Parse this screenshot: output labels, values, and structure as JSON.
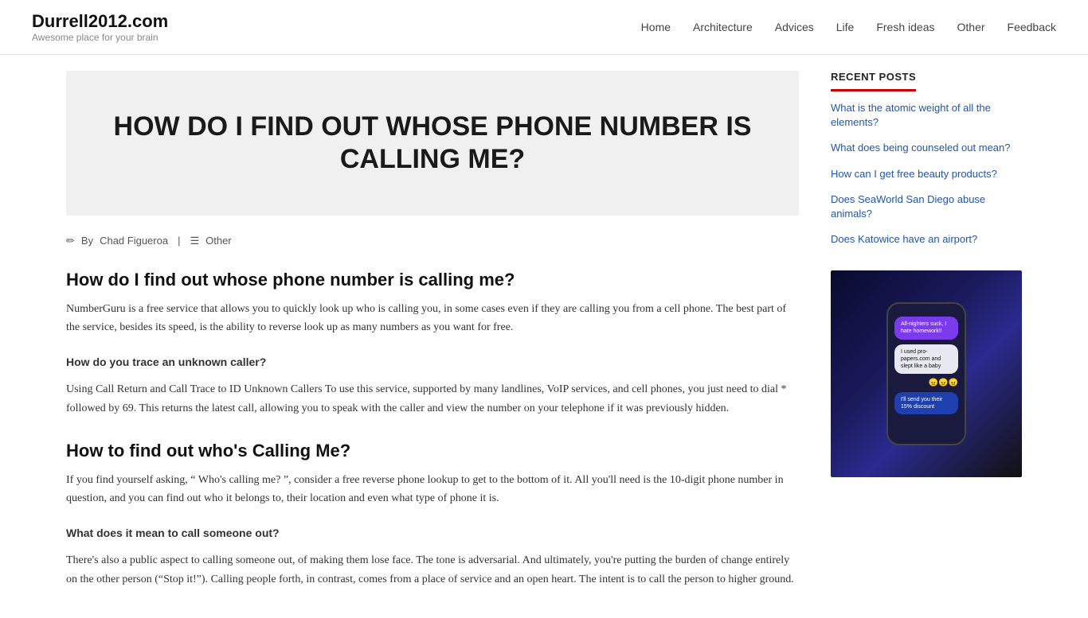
{
  "site": {
    "title": "Durrell2012.com",
    "tagline": "Awesome place for your brain"
  },
  "nav": {
    "items": [
      {
        "label": "Home",
        "href": "#"
      },
      {
        "label": "Architecture",
        "href": "#"
      },
      {
        "label": "Advices",
        "href": "#"
      },
      {
        "label": "Life",
        "href": "#"
      },
      {
        "label": "Fresh ideas",
        "href": "#"
      },
      {
        "label": "Other",
        "href": "#"
      },
      {
        "label": "Feedback",
        "href": "#"
      }
    ]
  },
  "hero": {
    "title": "HOW DO I FIND OUT WHOSE PHONE NUMBER IS CALLING ME?"
  },
  "post": {
    "author": "Chad Figueroa",
    "category": "Other",
    "intro": "How do I find out whose phone number is calling me?",
    "p1": "NumberGuru is a free service that allows you to quickly look up who is calling you, in some cases even if they are calling you from a cell phone. The best part of the service, besides its speed, is the ability to reverse look up as many numbers as you want for free.",
    "h_trace": "How do you trace an unknown caller?",
    "p_trace": "Using Call Return and Call Trace to ID Unknown Callers To use this service, supported by many landlines, VoIP services, and cell phones, you just need to dial * followed by 69. This returns the latest call, allowing you to speak with the caller and view the number on your telephone if it was previously hidden.",
    "h_find": "How to find out who's Calling Me?",
    "p_find": "If you find yourself asking, “ Who's calling me? ”, consider a free reverse phone lookup to get to the bottom of it. All you'll need is the 10-digit phone number in question, and you can find out who it belongs to, their location and even what type of phone it is.",
    "h_callout": "What does it mean to call someone out?",
    "p_callout": "There's also a public aspect to calling someone out, of making them lose face. The tone is adversarial. And ultimately, you're putting the burden of change entirely on the other person (“Stop it!”). Calling people forth, in contrast, comes from a place of service and an open heart. The intent is to call the person to higher ground."
  },
  "sidebar": {
    "recent_posts_label": "RECENT POSTS",
    "recent_posts": [
      {
        "label": "What is the atomic weight of all the elements?",
        "href": "#"
      },
      {
        "label": "What does being counseled out mean?",
        "href": "#"
      },
      {
        "label": "How can I get free beauty products?",
        "href": "#"
      },
      {
        "label": "Does SeaWorld San Diego abuse animals?",
        "href": "#"
      },
      {
        "label": "Does Katowice have an airport?",
        "href": "#"
      }
    ],
    "ad": {
      "bubble1": "All-nighters suck, I hate homework!!",
      "bubble2": "I used pro-papers.com and slept like a baby",
      "bubble3": "I'll send you their 15% discount"
    }
  }
}
